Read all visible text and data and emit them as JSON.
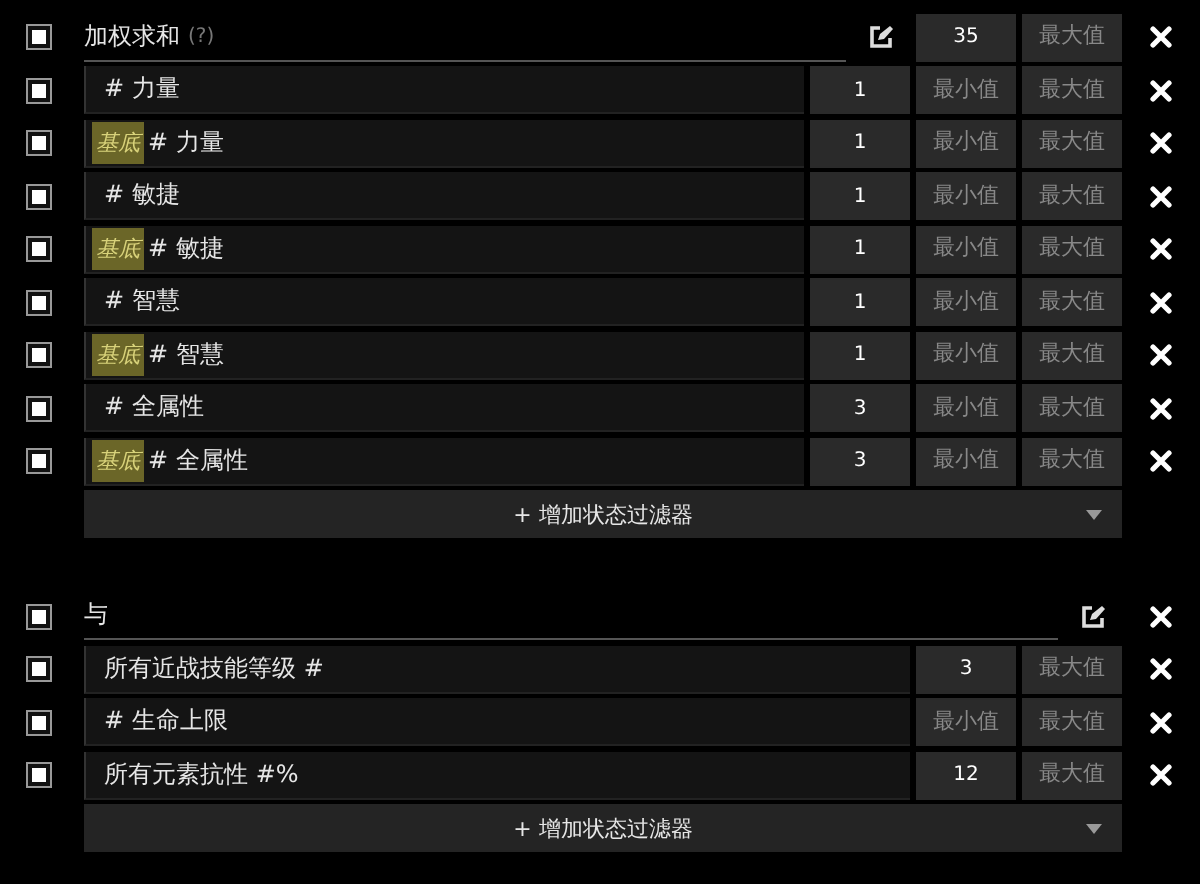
{
  "groups": [
    {
      "checked": true,
      "title": "加权求和",
      "help": "(?)",
      "min": {
        "value": "35"
      },
      "max": {
        "placeholder": "最大值"
      },
      "rows": [
        {
          "checked": true,
          "label": "# 力量",
          "weight": {
            "value": "1"
          },
          "min": {
            "placeholder": "最小值"
          },
          "max": {
            "placeholder": "最大值"
          }
        },
        {
          "checked": true,
          "tag": "基底",
          "label": "# 力量",
          "weight": {
            "value": "1"
          },
          "min": {
            "placeholder": "最小值"
          },
          "max": {
            "placeholder": "最大值"
          }
        },
        {
          "checked": true,
          "label": "# 敏捷",
          "weight": {
            "value": "1"
          },
          "min": {
            "placeholder": "最小值"
          },
          "max": {
            "placeholder": "最大值"
          }
        },
        {
          "checked": true,
          "tag": "基底",
          "label": "# 敏捷",
          "weight": {
            "value": "1"
          },
          "min": {
            "placeholder": "最小值"
          },
          "max": {
            "placeholder": "最大值"
          }
        },
        {
          "checked": true,
          "label": "# 智慧",
          "weight": {
            "value": "1"
          },
          "min": {
            "placeholder": "最小值"
          },
          "max": {
            "placeholder": "最大值"
          }
        },
        {
          "checked": true,
          "tag": "基底",
          "label": "# 智慧",
          "weight": {
            "value": "1"
          },
          "min": {
            "placeholder": "最小值"
          },
          "max": {
            "placeholder": "最大值"
          }
        },
        {
          "checked": true,
          "label": "# 全属性",
          "weight": {
            "value": "3"
          },
          "min": {
            "placeholder": "最小值"
          },
          "max": {
            "placeholder": "最大值"
          }
        },
        {
          "checked": true,
          "tag": "基底",
          "label": "# 全属性",
          "weight": {
            "value": "3"
          },
          "min": {
            "placeholder": "最小值"
          },
          "max": {
            "placeholder": "最大值"
          }
        }
      ],
      "add_button": "+ 增加状态过滤器"
    },
    {
      "checked": true,
      "title": "与",
      "rows": [
        {
          "checked": true,
          "label": "所有近战技能等级 #",
          "min": {
            "value": "3"
          },
          "max": {
            "placeholder": "最大值"
          }
        },
        {
          "checked": true,
          "label": "# 生命上限",
          "min": {
            "placeholder": "最小值"
          },
          "max": {
            "placeholder": "最大值"
          }
        },
        {
          "checked": true,
          "label": "所有元素抗性 #%",
          "min": {
            "value": "12"
          },
          "max": {
            "placeholder": "最大值"
          }
        }
      ],
      "add_button": "+ 增加状态过滤器"
    }
  ]
}
